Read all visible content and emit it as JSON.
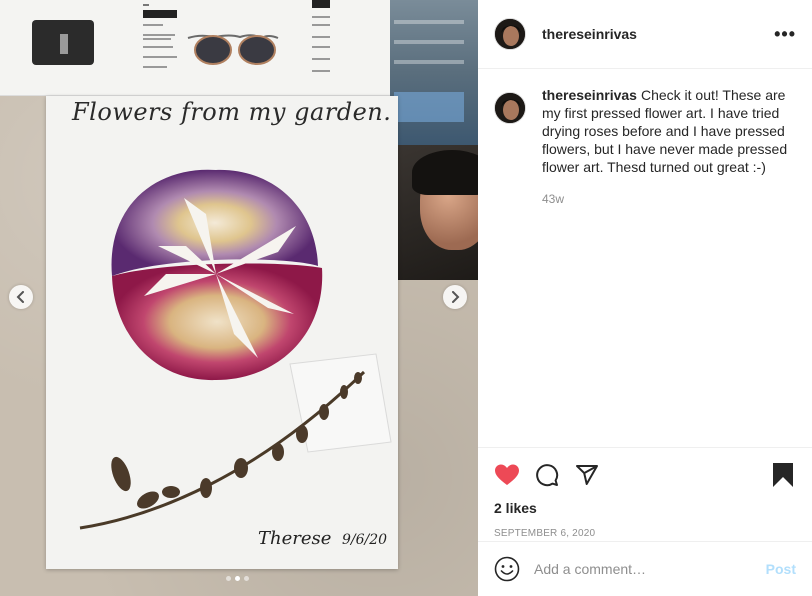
{
  "post": {
    "username": "thereseinrivas",
    "more_icon": "more-horizontal-icon",
    "more_label": "•••"
  },
  "media": {
    "paper_title": "Flowers from my garden.",
    "signature": "Therese",
    "signature_date": "9/6/20",
    "slide_count": 3,
    "active_slide": 2,
    "prev_icon": "chevron-left-icon",
    "next_icon": "chevron-right-icon"
  },
  "caption": {
    "username": "thereseinrivas",
    "text": "Check it out! These are my first pressed flower art. I have tried drying roses before and I have pressed flowers, but I have never made pressed flower art. Thesd turned out great :-)",
    "time": "43w"
  },
  "actions": {
    "like_icon": "heart-filled-icon",
    "comment_icon": "comment-icon",
    "share_icon": "share-icon",
    "save_icon": "bookmark-filled-icon",
    "like_color": "#ed4956"
  },
  "likes": "2 likes",
  "date": "SEPTEMBER 6, 2020",
  "comment_box": {
    "emoji_icon": "emoji-icon",
    "placeholder": "Add a comment…",
    "post_label": "Post"
  },
  "colors": {
    "text": "#262626",
    "secondary": "#8e8e8e",
    "post_disabled": "#b2dffc",
    "border": "#efefef"
  }
}
